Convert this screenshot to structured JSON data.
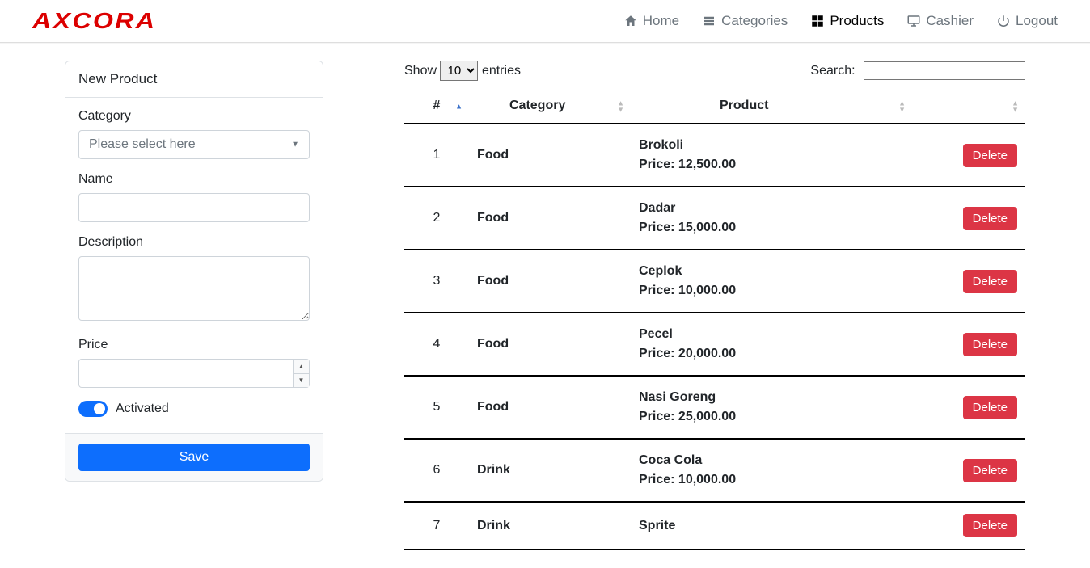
{
  "logo": "AXCORA",
  "nav": {
    "home": "Home",
    "categories": "Categories",
    "products": "Products",
    "cashier": "Cashier",
    "logout": "Logout"
  },
  "form": {
    "title": "New Product",
    "category_label": "Category",
    "category_placeholder": "Please select here",
    "name_label": "Name",
    "name_value": "",
    "description_label": "Description",
    "description_value": "",
    "price_label": "Price",
    "price_value": "",
    "activated_label": "Activated",
    "save_label": "Save"
  },
  "table": {
    "show_label": "Show",
    "entries_label": "entries",
    "page_size": "10",
    "search_label": "Search:",
    "search_value": "",
    "headers": {
      "num": "#",
      "category": "Category",
      "product": "Product",
      "actions": ""
    },
    "delete_label": "Delete",
    "price_prefix": "Price: ",
    "rows": [
      {
        "num": "1",
        "category": "Food",
        "name": "Brokoli",
        "price": "12,500.00"
      },
      {
        "num": "2",
        "category": "Food",
        "name": "Dadar",
        "price": "15,000.00"
      },
      {
        "num": "3",
        "category": "Food",
        "name": "Ceplok",
        "price": "10,000.00"
      },
      {
        "num": "4",
        "category": "Food",
        "name": "Pecel",
        "price": "20,000.00"
      },
      {
        "num": "5",
        "category": "Food",
        "name": "Nasi Goreng",
        "price": "25,000.00"
      },
      {
        "num": "6",
        "category": "Drink",
        "name": "Coca Cola",
        "price": "10,000.00"
      },
      {
        "num": "7",
        "category": "Drink",
        "name": "Sprite",
        "price": ""
      }
    ]
  }
}
